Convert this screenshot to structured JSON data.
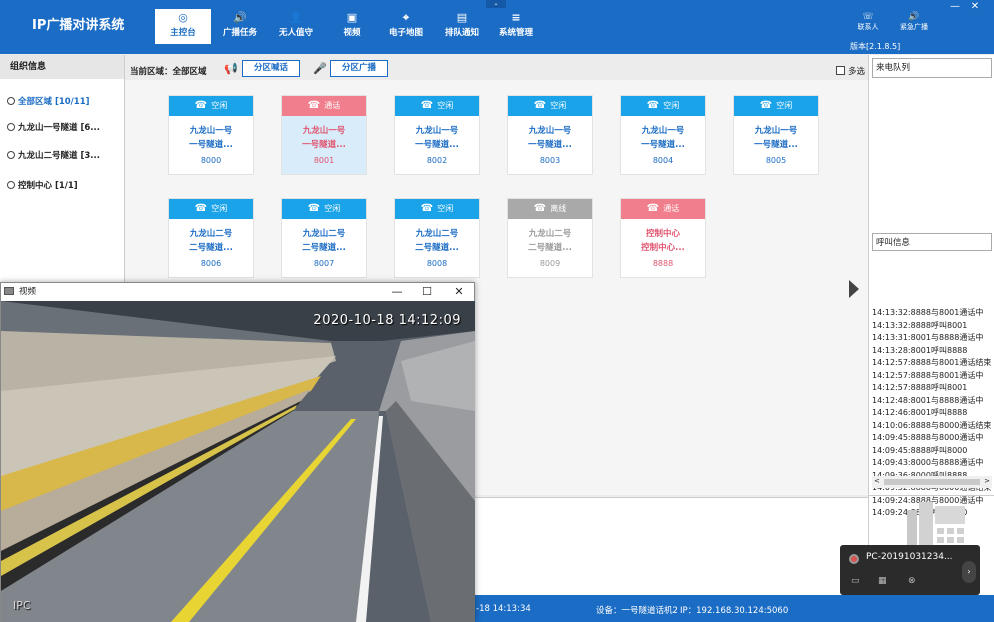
{
  "app": {
    "title": "IP广播对讲系统",
    "version": "版本[2.1.8.5]"
  },
  "nav": [
    {
      "label": "主控台",
      "icon": "◎"
    },
    {
      "label": "广播任务",
      "icon": "🔊"
    },
    {
      "label": "无人值守",
      "icon": "👤"
    },
    {
      "label": "视频",
      "icon": "▣"
    },
    {
      "label": "电子地图",
      "icon": "⌖"
    },
    {
      "label": "排队通知",
      "icon": "▤"
    },
    {
      "label": "系统管理",
      "icon": "≡"
    }
  ],
  "top_right": {
    "contacts": "联系人",
    "emergency": "紧急广播",
    "contacts_icon": "☏",
    "emergency_icon": "🔊"
  },
  "window_controls": {
    "minimize": "—",
    "close": "✕"
  },
  "drop_tab": "⌄",
  "left": {
    "header": "组织信息",
    "items": [
      "全部区域 [10/11]",
      "九龙山一号隧道 [6...",
      "九龙山二号隧道 [3...",
      "控制中心 [1/1]"
    ]
  },
  "toolbar": {
    "current_area": "当前区域：全部区域",
    "zone_call": "分区喊话",
    "zone_broadcast": "分区广播",
    "multi_select": "多选",
    "call_icon": "📢",
    "mic_icon": "🎤"
  },
  "terminals": [
    {
      "status": "空闲",
      "state": "idle",
      "l1": "九龙山一号",
      "l2": "一号隧道...",
      "num": "8000"
    },
    {
      "status": "通话",
      "state": "call",
      "l1": "九龙山一号",
      "l2": "一号隧道...",
      "num": "8001"
    },
    {
      "status": "空闲",
      "state": "idle",
      "l1": "九龙山一号",
      "l2": "一号隧道...",
      "num": "8002"
    },
    {
      "status": "空闲",
      "state": "idle",
      "l1": "九龙山一号",
      "l2": "一号隧道...",
      "num": "8003"
    },
    {
      "status": "空闲",
      "state": "idle",
      "l1": "九龙山一号",
      "l2": "一号隧道...",
      "num": "8004"
    },
    {
      "status": "空闲",
      "state": "idle",
      "l1": "九龙山一号",
      "l2": "一号隧道...",
      "num": "8005"
    },
    {
      "status": "空闲",
      "state": "idle",
      "l1": "九龙山二号",
      "l2": "二号隧道...",
      "num": "8006"
    },
    {
      "status": "空闲",
      "state": "idle",
      "l1": "九龙山二号",
      "l2": "二号隧道...",
      "num": "8007"
    },
    {
      "status": "空闲",
      "state": "idle",
      "l1": "九龙山二号",
      "l2": "二号隧道...",
      "num": "8008"
    },
    {
      "status": "离线",
      "state": "offline",
      "l1": "九龙山二号",
      "l2": "二号隧道...",
      "num": "8009"
    },
    {
      "status": "通话",
      "state": "call",
      "l1": "控制中心",
      "l2": "控制中心...",
      "num": "8888"
    }
  ],
  "right": {
    "incoming_queue": "来电队列",
    "call_info": "呼叫信息",
    "log": [
      "14:13:32:8888与8001通话中",
      "14:13:32:8888呼叫8001",
      "14:13:31:8001与8888通话中",
      "14:13:28:8001呼叫8888",
      "14:12:57:8888与8001通话结束",
      "14:12:57:8888与8001通话中",
      "14:12:57:8888呼叫8001",
      "14:12:48:8001与8888通话中",
      "14:12:46:8001呼叫8888",
      "14:10:06:8888与8000通话结束",
      "14:09:45:8888与8000通话中",
      "14:09:45:8888呼叫8000",
      "14:09:43:8000与8888通话中",
      "14:09:36:8000呼叫8888",
      "14:09:32:8888与8000通话结束",
      "14:09:24:8888与8000通话中",
      "14:09:24:8888呼叫8000"
    ]
  },
  "video": {
    "title": "视频",
    "timestamp": "2020-10-18 14:12:09",
    "camera": "IPC",
    "min": "—",
    "max": "☐",
    "close": "✕"
  },
  "status": {
    "time": "-18 14:13:34",
    "device": "设备：一号隧道话机2",
    "ip": "IP：192.168.30.124:5060"
  },
  "notification": {
    "title": "PC-20191031234...",
    "arrow": "›"
  },
  "colors": {
    "brand": "#1b6cc4",
    "idle": "#1aa3e8",
    "call": "#f07e8c",
    "offline": "#a9a9a9"
  }
}
